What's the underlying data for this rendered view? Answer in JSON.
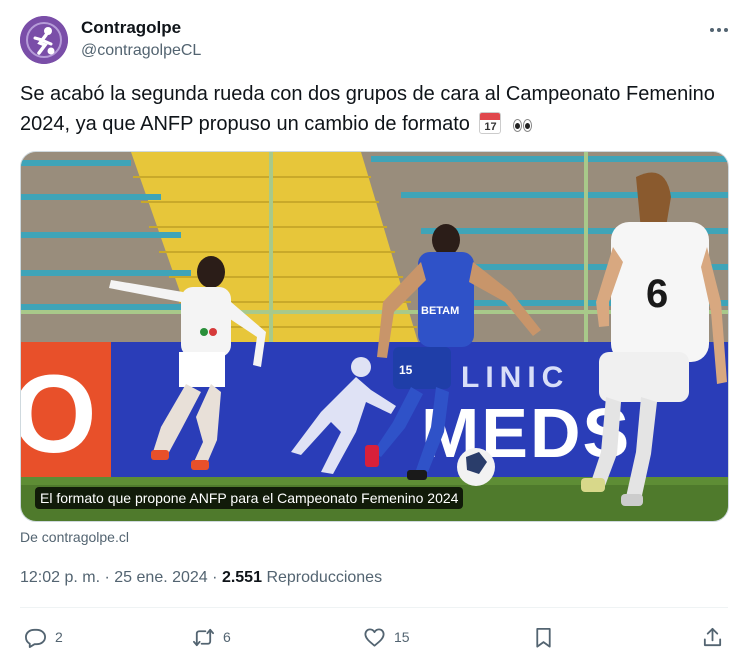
{
  "author": {
    "display_name": "Contragolpe",
    "handle": "@contragolpeCL",
    "avatar_icon": "contragolpe-logo-icon",
    "avatar_color": "#7a4ea8"
  },
  "tweet": {
    "text": "Se acabó la segunda rueda con dos grupos de cara al Campeonato Femenino 2024, ya que ANFP propuso un cambio de formato",
    "emoji_calendar_month": "JUL",
    "emoji_calendar_day": "17",
    "emojis": [
      "calendar-icon",
      "eyes-icon"
    ]
  },
  "media": {
    "caption": "El formato que propone ANFP para el Campeonato Femenino 2024",
    "board_text": "CLINICA MEDS",
    "sponsor_text": "BETAM",
    "player_number_left": "15",
    "player_number_right": "6"
  },
  "source": "De contragolpe.cl",
  "meta": {
    "time": "12:02 p. m.",
    "separator": "·",
    "date": "25 ene. 2024",
    "views_count": "2.551",
    "views_label": "Reproducciones"
  },
  "actions": {
    "replies": "2",
    "retweets": "6",
    "likes": "15"
  },
  "colors": {
    "text_primary": "#0f1419",
    "text_secondary": "#536471",
    "border": "#cfd9de"
  }
}
